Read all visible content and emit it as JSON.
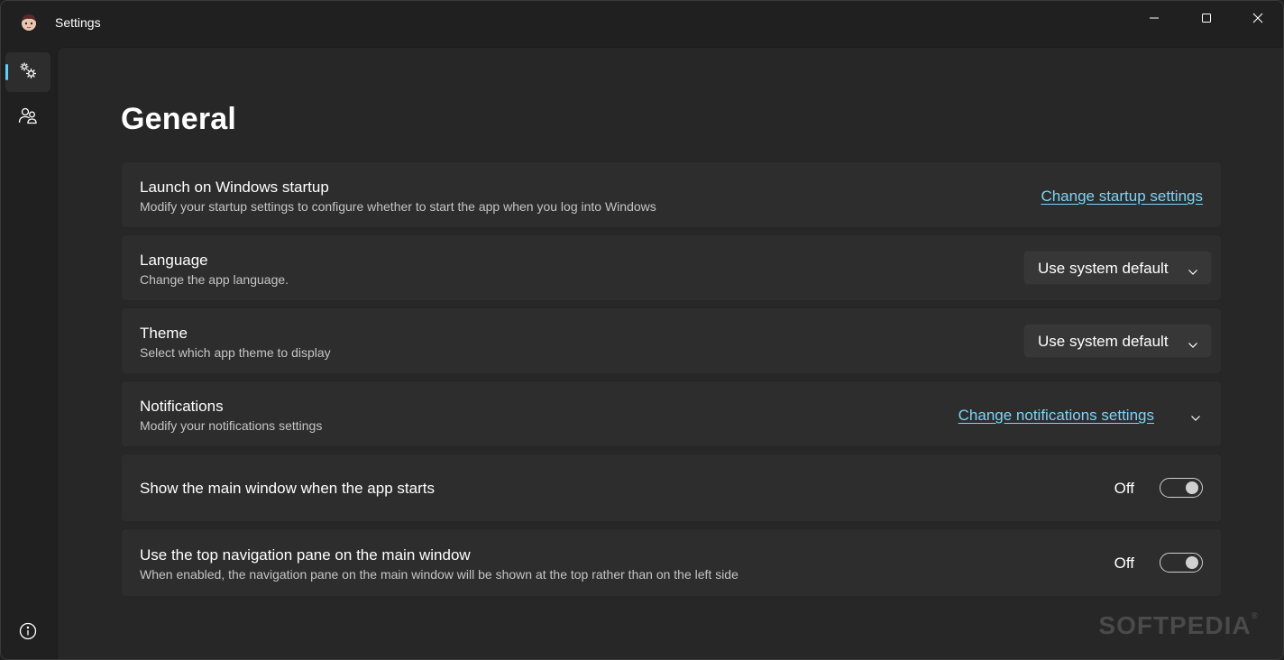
{
  "window": {
    "title": "Settings",
    "caption": {
      "minimize_icon": "minimize-icon",
      "maximize_icon": "maximize-icon",
      "close_icon": "close-icon"
    }
  },
  "nav": {
    "items": [
      {
        "icon": "gears-icon",
        "selected": true
      },
      {
        "icon": "people-icon",
        "selected": false
      }
    ],
    "footer_icon": "info-icon"
  },
  "page": {
    "title": "General",
    "cards": {
      "startup": {
        "title": "Launch on Windows startup",
        "description": "Modify your startup settings to configure whether to start the app when you log into Windows",
        "link": "Change startup settings"
      },
      "language": {
        "title": "Language",
        "description": "Change the app language.",
        "selected": "Use system default"
      },
      "theme": {
        "title": "Theme",
        "description": "Select which app theme to display",
        "selected": "Use system default"
      },
      "notifications": {
        "title": "Notifications",
        "description": "Modify your notifications settings",
        "link": "Change notifications settings"
      },
      "show_main_window": {
        "title": "Show the main window when the app starts",
        "state_label": "Off",
        "on": false
      },
      "top_nav": {
        "title": "Use the top navigation pane on the main window",
        "description": "When enabled, the navigation pane on the main window will be shown at the top rather than on the left side",
        "state_label": "Off",
        "on": false
      }
    }
  },
  "watermark": "SOFTPEDIA",
  "colors": {
    "accent": "#60cdff",
    "link": "#7fd3f7",
    "card": "#2d2d2d",
    "background": "#272727"
  }
}
